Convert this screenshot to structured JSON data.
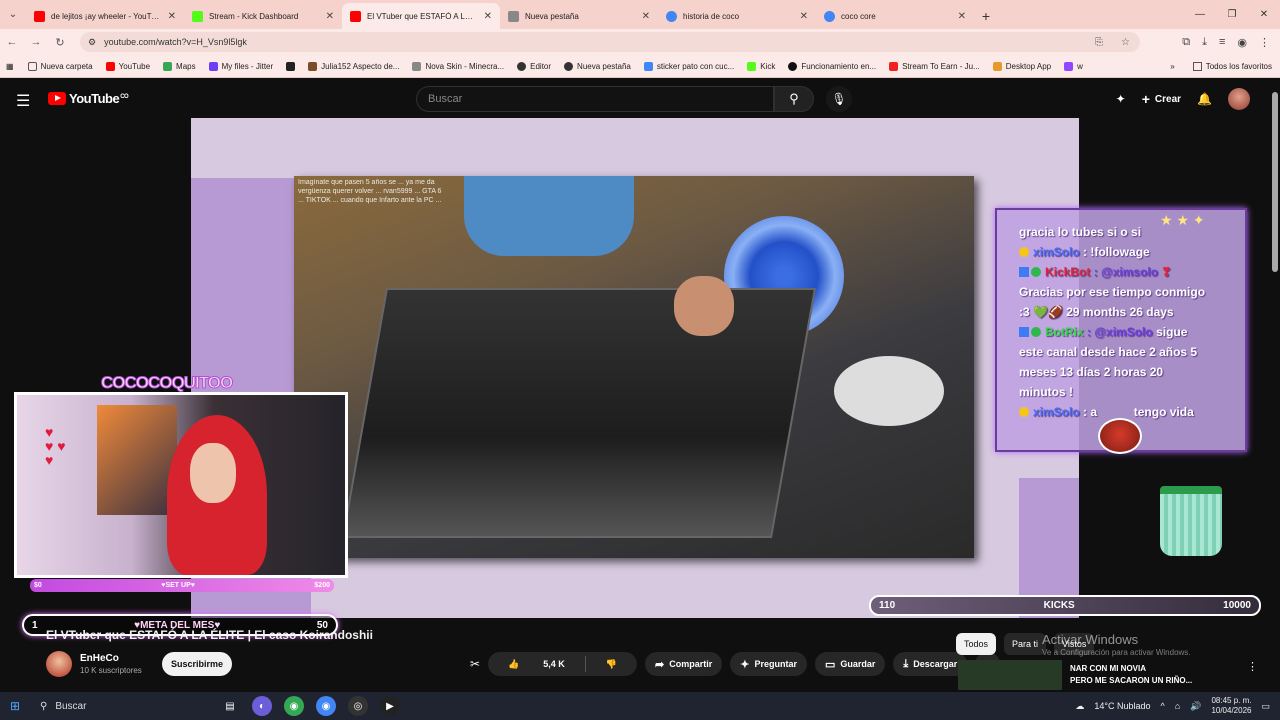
{
  "browser": {
    "tabs": [
      {
        "title": "de lejitos ¡ay wheeler - YouTube",
        "color": "#ff0000"
      },
      {
        "title": "Stream - Kick Dashboard",
        "color": "#53fc18"
      },
      {
        "title": "El VTuber que ESTAFÓ A LA ÉLI",
        "color": "#ff0000"
      },
      {
        "title": "Nueva pestaña",
        "color": "#888888"
      },
      {
        "title": "historia de coco",
        "color": "#4285f4"
      },
      {
        "title": "coco core",
        "color": "#4285f4"
      }
    ],
    "url": "youtube.com/watch?v=H_Vsn9l5lgk",
    "bookmarks": [
      "Nueva carpeta",
      "YouTube",
      "Maps",
      "My files - Jitter",
      "",
      "Julia152 Aspecto de...",
      "Nova Skin - Minecra...",
      "Editor",
      "Nueva pestaña",
      "sticker pato con cuc...",
      "Kick",
      "Funcionamiento en...",
      "Stream To Earn - Ju...",
      "Desktop App",
      "w"
    ],
    "bookmarks_all": "Todos los favoritos"
  },
  "youtube": {
    "logo_text": "YouTube",
    "logo_sup": "CO",
    "search_placeholder": "Buscar",
    "create_label": "Crear"
  },
  "overlay": {
    "tiktok_lines": "Imagínate que pasen 5 años se ... ya me da vergüenza querer volver ... rvan5999 ... GTA 6 ... TIKTOK ... cuando que Infarto ante la PC ...",
    "cam_title": "COCOCOQUITOO",
    "money_left": "$0",
    "money_mid": "♥SET UP♥",
    "money_right": "$200",
    "meta_left": "1",
    "meta_mid": "♥META DEL MES♥",
    "meta_right": "50",
    "kicks_left": "110",
    "kicks_mid": "KICKS",
    "kicks_right": "10000"
  },
  "chat": {
    "line1": "gracia lo tubes si o si",
    "line2_user": "ximSolo",
    "line2_text": ": !followage",
    "line3_user": "KickBot",
    "line3_mention": ": @ximsolo",
    "line4": "Gracias por ese tiempo conmigo",
    "line5": ":3 💚🏈 29 months 26 days",
    "line6_user": "BotRix",
    "line6_mention": ": @ximSolo",
    "line6_text": "sigue",
    "line7": "este canal desde hace 2 años 5",
    "line8": "meses 13 días 2 horas 20",
    "line9": "minutos !",
    "line10_user": "ximSolo",
    "line10_text": ": a",
    "line10_end": "tengo vida"
  },
  "video": {
    "title": "El VTuber que ESTAFÓ A LA ÉLITE | El caso Koirandoshii",
    "channel_name": "EnHeCo",
    "channel_subs": "10 K suscriptores",
    "subscribe_label": "Suscribirme",
    "like_count": "5,4 K",
    "share_label": "Compartir",
    "ask_label": "Preguntar",
    "save_label": "Guardar",
    "download_label": "Descargar"
  },
  "sidebar_chips": {
    "all": "Todos",
    "for_you": "Para ti",
    "seen": "Vistos"
  },
  "windows_activation": {
    "title": "Activar Windows",
    "subtitle": "Ve a Configuración para activar Windows."
  },
  "recommended": {
    "line1": "NAR CON MI NOVIA",
    "line2": "PERO ME SACARON UN RIÑO..."
  },
  "taskbar": {
    "search": "Buscar",
    "weather": "14°C  Nublado",
    "time": "08:45 p. m.",
    "date": "10/04/2026"
  }
}
